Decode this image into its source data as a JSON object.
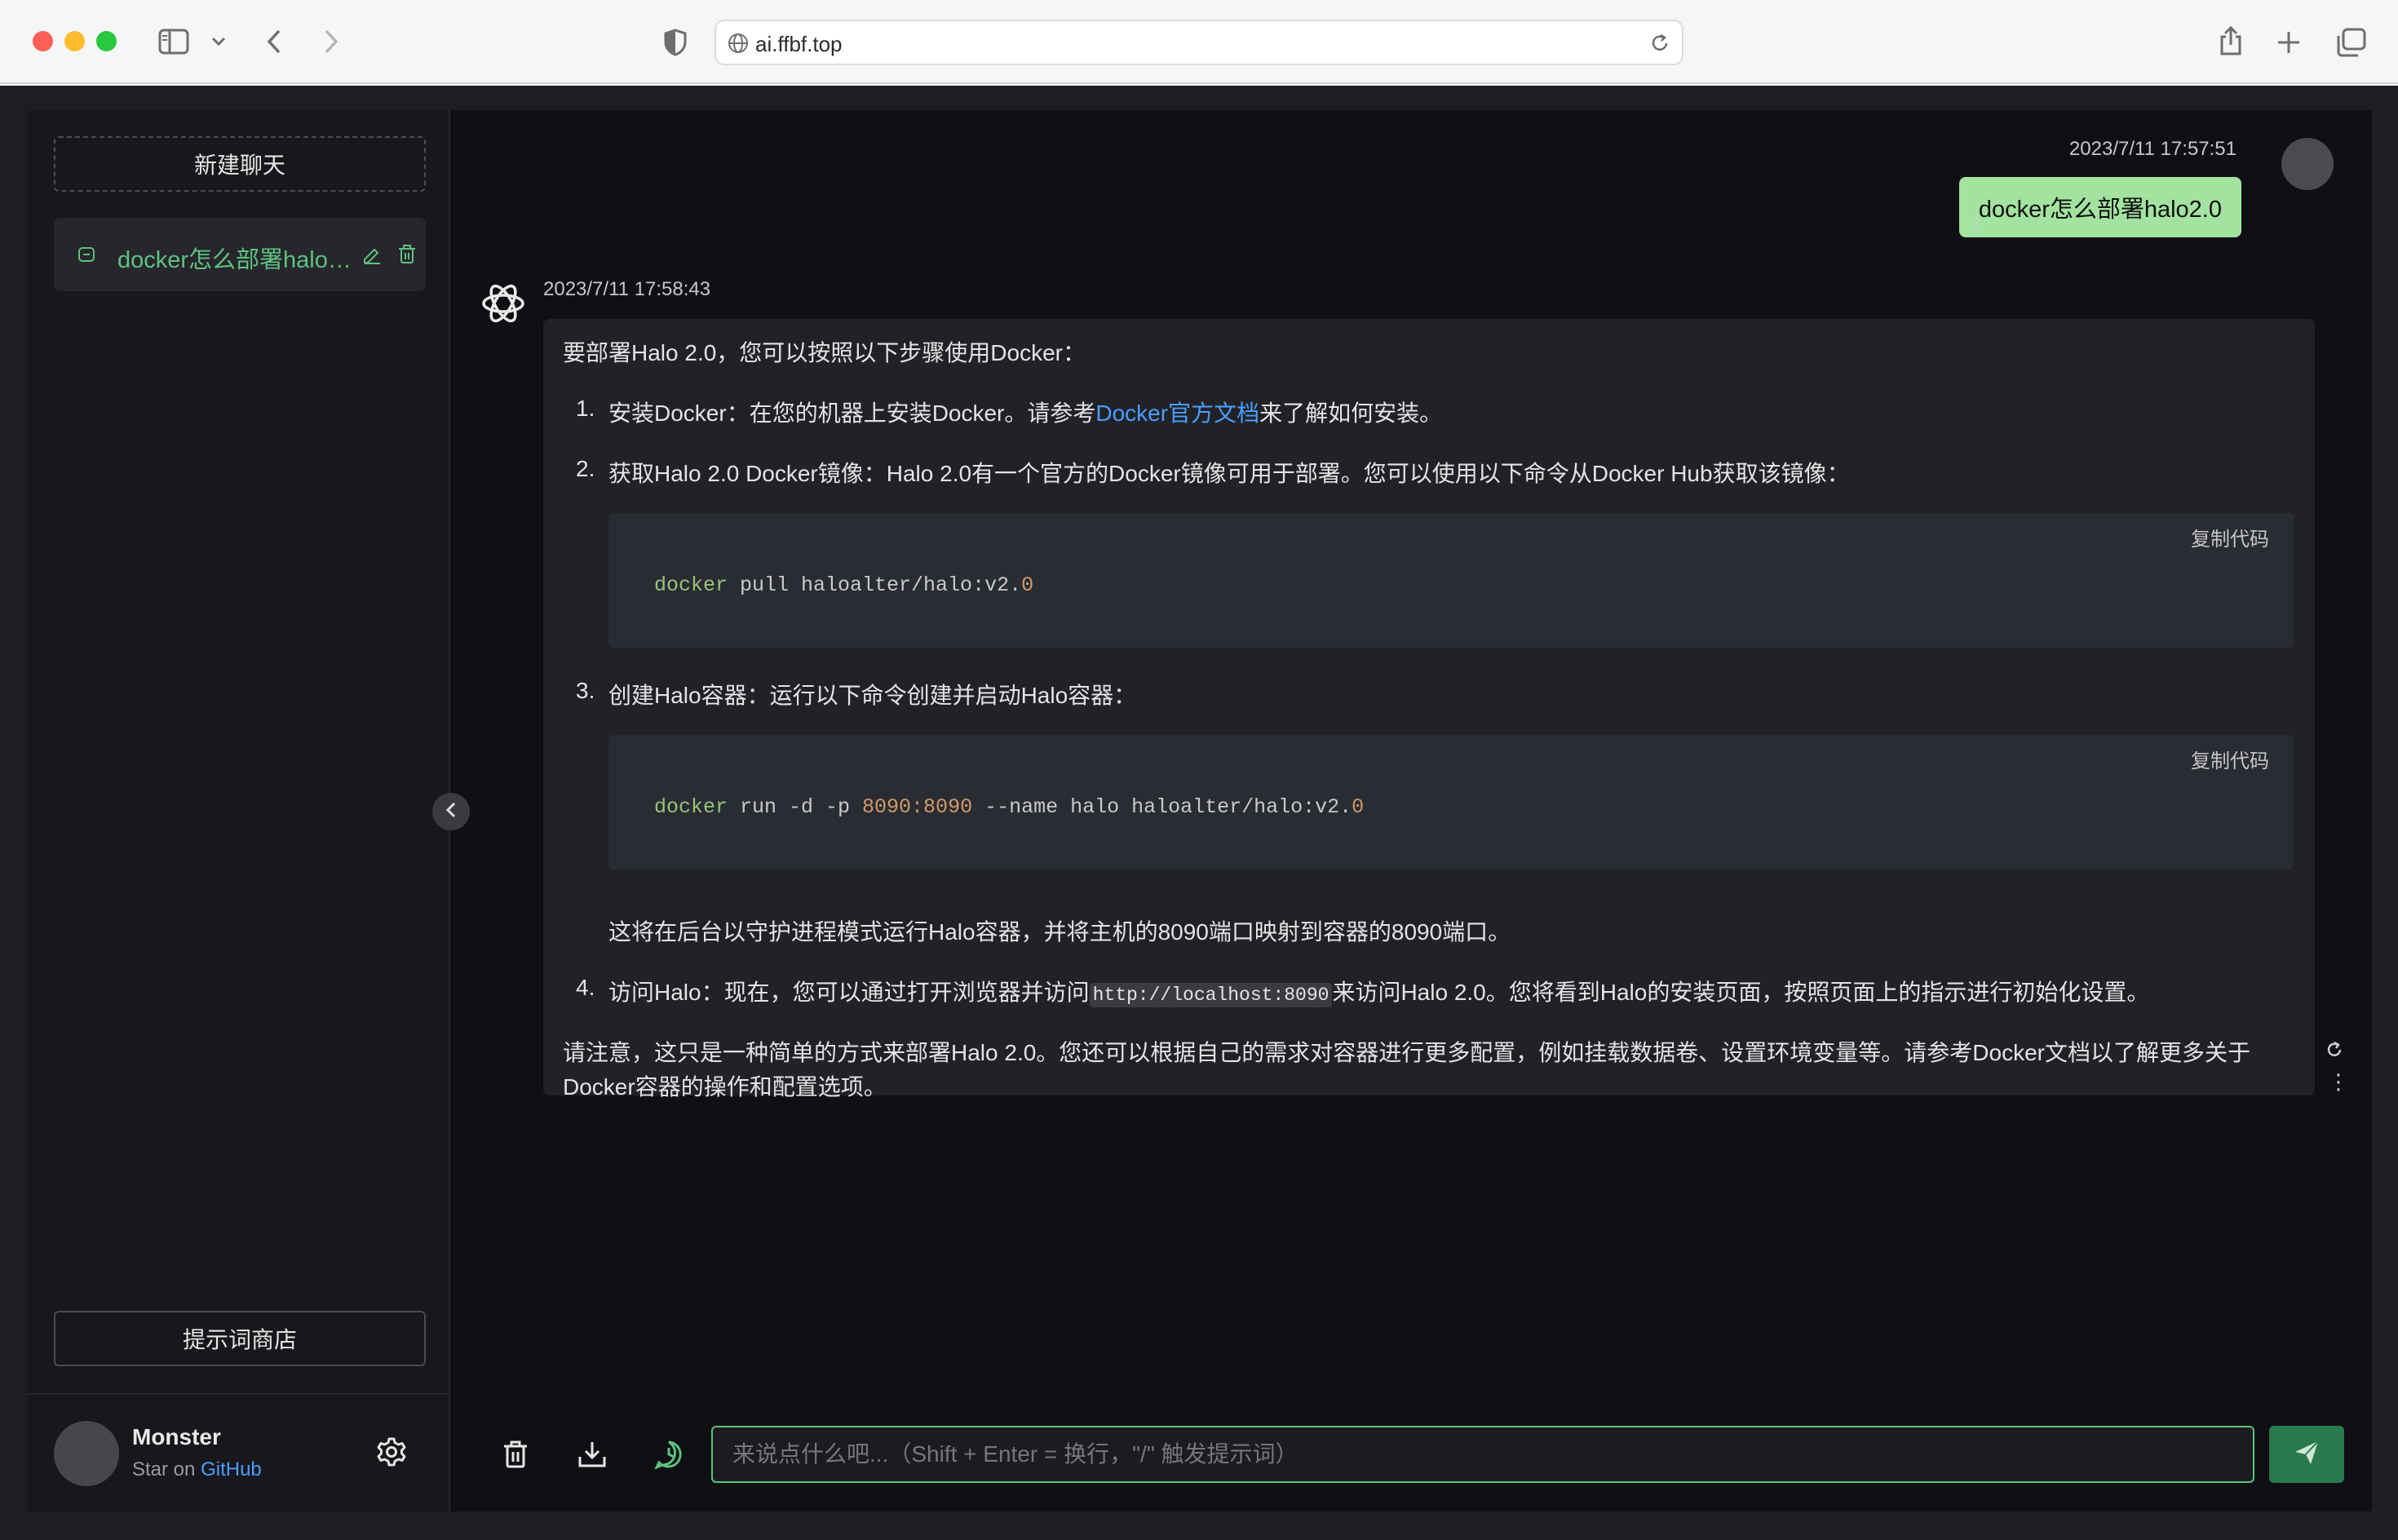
{
  "browser": {
    "url": "ai.ffbf.top"
  },
  "sidebar": {
    "new_chat_label": "新建聊天",
    "history": [
      {
        "title": "docker怎么部署halo2.0"
      }
    ],
    "prompt_store_label": "提示词商店",
    "user": {
      "name": "Monster",
      "star_prefix": "Star on",
      "star_link": "GitHub"
    }
  },
  "chat": {
    "user_message": {
      "timestamp": "2023/7/11 17:57:51",
      "text": "docker怎么部署halo2.0"
    },
    "bot_message": {
      "timestamp": "2023/7/11 17:58:43",
      "intro": "要部署Halo 2.0，您可以按照以下步骤使用Docker：",
      "step1": {
        "num": "1.",
        "before": "安装Docker：在您的机器上安装Docker。请参考",
        "link": "Docker官方文档",
        "after": "来了解如何安装。"
      },
      "step2": {
        "num": "2.",
        "text": "获取Halo 2.0 Docker镜像：Halo 2.0有一个官方的Docker镜像可用于部署。您可以使用以下命令从Docker Hub获取该镜像："
      },
      "code1": {
        "copy_label": "复制代码",
        "cmd": "docker",
        "rest": " pull haloalter/halo:v2.",
        "tail": "0"
      },
      "step3": {
        "num": "3.",
        "text": "创建Halo容器：运行以下命令创建并启动Halo容器："
      },
      "code2": {
        "copy_label": "复制代码",
        "cmd": "docker",
        "mid1": " run -d -p ",
        "ports": "8090:8090",
        "mid2": " --name halo haloalter/halo:v2.",
        "tail": "0"
      },
      "step3_note": "这将在后台以守护进程模式运行Halo容器，并将主机的8090端口映射到容器的8090端口。",
      "step4": {
        "num": "4.",
        "before": "访问Halo：现在，您可以通过打开浏览器并访问",
        "code": "http://localhost:8090",
        "after": "来访问Halo 2.0。您将看到Halo的安装页面，按照页面上的指示进行初始化设置。"
      },
      "outro_line1": "请注意，这只是一种简单的方式来部署Halo 2.0。您还可以根据自己的需求对容器进行更多配置，例如挂载数据卷、设置环境变量等。请参考Docker文档以了解更多关于",
      "outro_line2": "Docker容器的操作和配置选项。"
    }
  },
  "input": {
    "placeholder": "来说点什么吧...（Shift + Enter = 换行，\"/\" 触发提示词）",
    "value": ""
  },
  "colors": {
    "accent_green": "#5ec27f",
    "user_bubble": "#a2e3a0",
    "link_blue": "#4a9eff",
    "send_button": "#2a7a4e"
  }
}
